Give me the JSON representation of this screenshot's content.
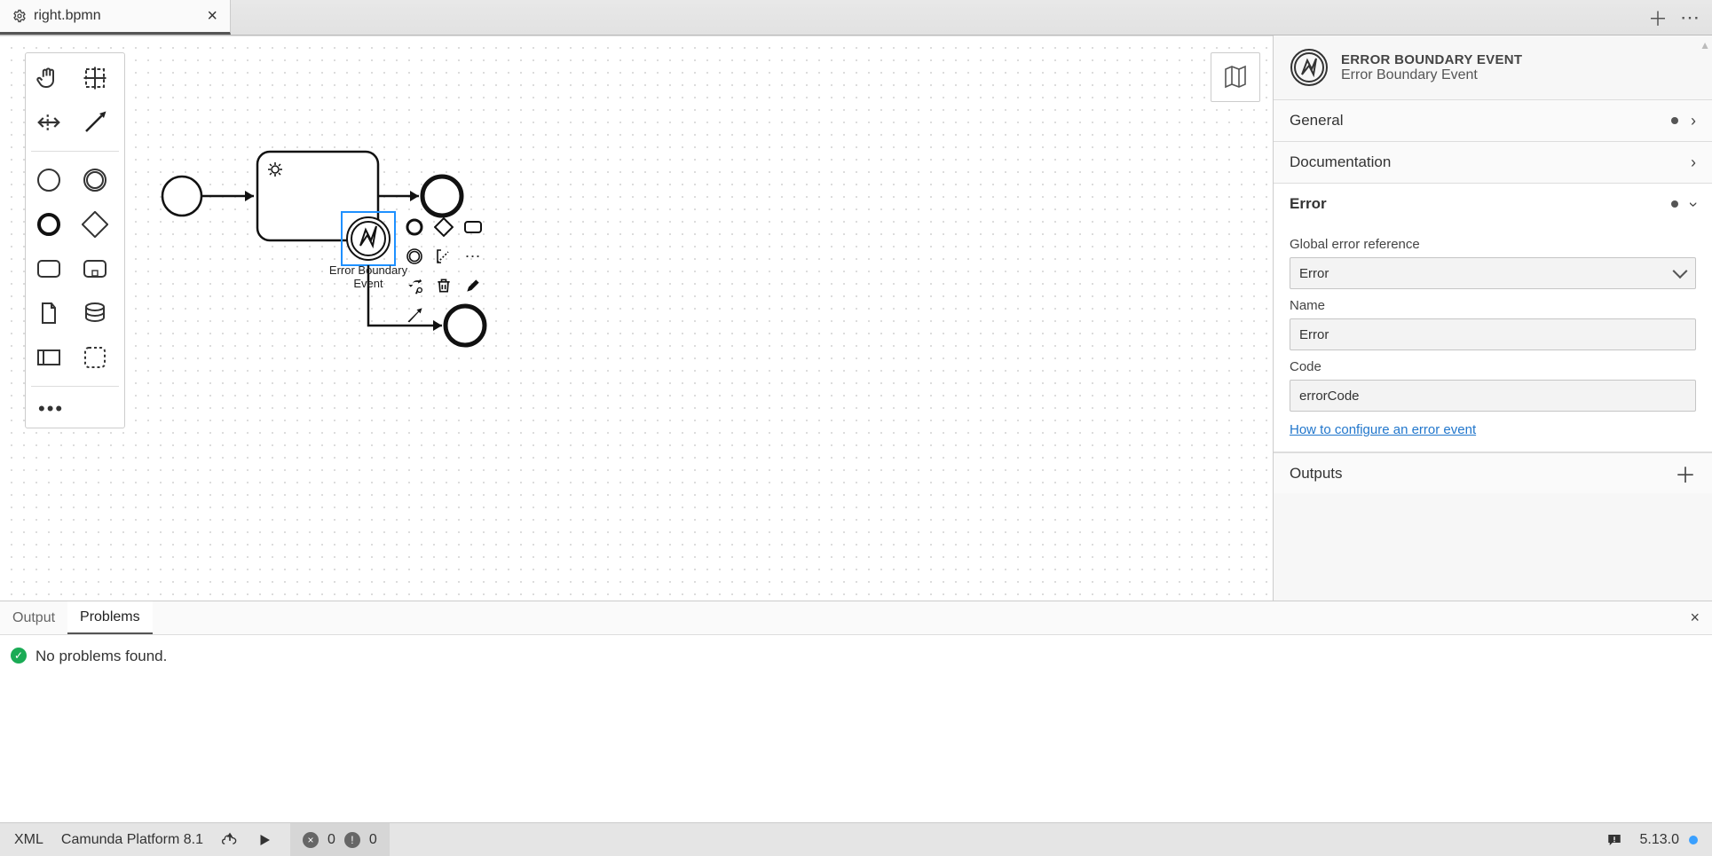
{
  "tab": {
    "title": "right.bpmn"
  },
  "palette": {
    "tools": [
      "hand",
      "lasso",
      "space",
      "connect",
      "start-event",
      "intermediate-event",
      "end-event",
      "gateway",
      "task",
      "data-store",
      "data-object",
      "data-ref",
      "participant",
      "group"
    ]
  },
  "diagram": {
    "selected_label": "Error Boundary Event"
  },
  "props": {
    "title": "ERROR BOUNDARY EVENT",
    "subtitle": "Error Boundary Event",
    "sections": {
      "general": {
        "label": "General",
        "hasData": true
      },
      "documentation": {
        "label": "Documentation"
      },
      "error": {
        "label": "Error",
        "hasData": true,
        "global_ref_label": "Global error reference",
        "global_ref_value": "Error",
        "name_label": "Name",
        "name_value": "Error",
        "code_label": "Code",
        "code_value": "errorCode",
        "help_text": "How to configure an error event"
      },
      "outputs": {
        "label": "Outputs"
      }
    }
  },
  "bottomPanel": {
    "tabs": {
      "output": "Output",
      "problems": "Problems"
    },
    "message": "No problems found."
  },
  "statusbar": {
    "xml": "XML",
    "platform": "Camunda Platform 8.1",
    "errors": "0",
    "warnings": "0",
    "version": "5.13.0"
  }
}
